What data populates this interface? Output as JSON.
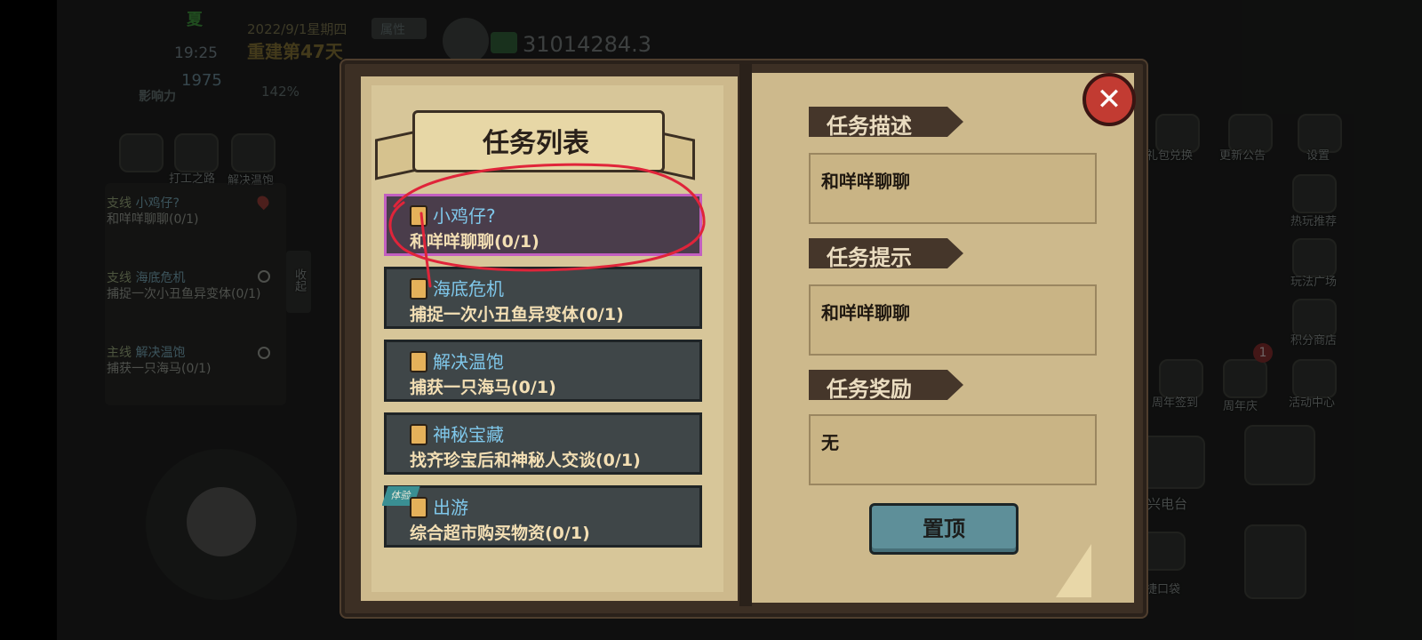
{
  "hud": {
    "season": "夏",
    "date": "2022/9/1星期四",
    "day_status": "重建第47天",
    "time": "19:25",
    "attribute_button": "属性",
    "influence_value": "1975",
    "influence_label": "影响力",
    "percent": "142%",
    "money": "31014284.3"
  },
  "left_hud": {
    "shortcuts": [
      "打工之路",
      "解决温饱"
    ],
    "collapse_label": "收起",
    "quests": [
      {
        "tag": "支线",
        "name": "小鸡仔?",
        "desc": "和咩咩聊聊(0/1)"
      },
      {
        "tag": "支线",
        "name": "海底危机",
        "desc": "捕捉一次小丑鱼异变体(0/1)"
      },
      {
        "tag": "主线",
        "name": "解决温饱",
        "desc": "捕获一只海马(0/1)"
      }
    ]
  },
  "right_hud": {
    "items": [
      "礼包兑换",
      "更新公告",
      "设置",
      "热玩推荐",
      "玩法广场",
      "积分商店",
      "周年签到",
      "周年庆",
      "活动中心",
      "永兴电台",
      "便捷口袋"
    ],
    "badge_count": "1"
  },
  "panel": {
    "list_title": "任务列表",
    "quests": [
      {
        "name": "小鸡仔?",
        "desc": "和咩咩聊聊(0/1)",
        "selected": true
      },
      {
        "name": "海底危机",
        "desc": "捕捉一次小丑鱼异变体(0/1)"
      },
      {
        "name": "解决温饱",
        "desc": "捕获一只海马(0/1)"
      },
      {
        "name": "神秘宝藏",
        "desc": "找齐珍宝后和神秘人交谈(0/1)"
      },
      {
        "name": "出游",
        "desc": "综合超市购买物资(0/1)",
        "badge": "体验"
      }
    ],
    "description_title": "任务描述",
    "description_text": "和咩咩聊聊",
    "hint_title": "任务提示",
    "hint_text": "和咩咩聊聊",
    "reward_title": "任务奖励",
    "reward_text": "无",
    "pin_button": "置顶"
  },
  "colors": {
    "parchment": "#cdb98c",
    "quest_card": "#3f4648",
    "quest_name": "#7fc7ea",
    "quest_desc": "#f3dfb4",
    "selected_border": "#c25fc0",
    "annotation": "#e0243a",
    "close_button": "#c23b32",
    "pin_button": "#5e8f99"
  }
}
